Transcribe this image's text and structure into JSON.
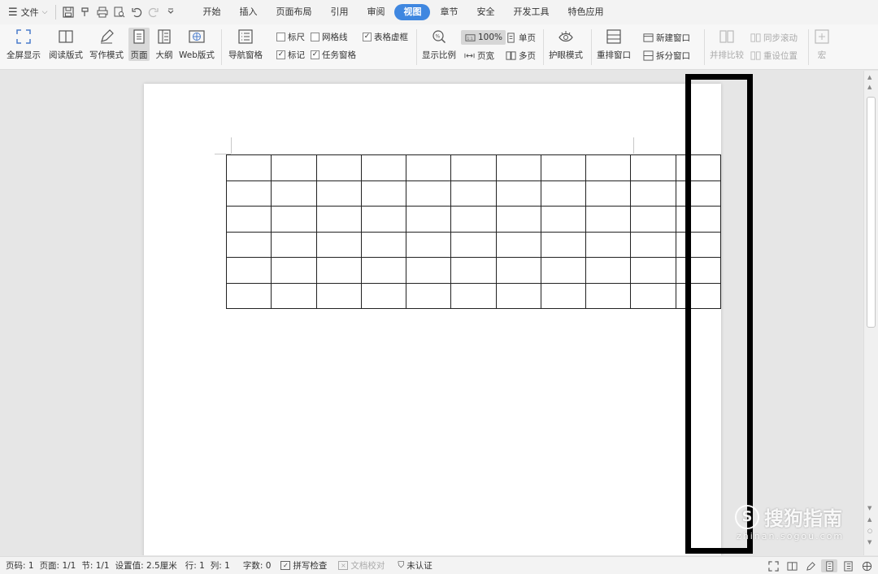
{
  "menubar": {
    "file_label": "文件",
    "tabs": [
      "开始",
      "插入",
      "页面布局",
      "引用",
      "审阅",
      "视图",
      "章节",
      "安全",
      "开发工具",
      "特色应用"
    ],
    "active_tab": "视图"
  },
  "ribbon": {
    "fullscreen": "全屏显示",
    "reading": "阅读版式",
    "writing": "写作模式",
    "page": "页面",
    "outline": "大纲",
    "web": "Web版式",
    "nav_pane": "导航窗格",
    "ruler": "标尺",
    "gridlines": "网格线",
    "table_gridlines": "表格虚框",
    "marks": "标记",
    "task_pane": "任务窗格",
    "zoom": "显示比例",
    "zoom_value": "100%",
    "page_width": "页宽",
    "single_page": "单页",
    "multi_page": "多页",
    "eye_mode": "护眼模式",
    "rearrange": "重排窗口",
    "new_window": "新建窗口",
    "split_window": "拆分窗口",
    "side_by_side": "并排比较",
    "sync_scroll": "同步滚动",
    "reset_position": "重设位置",
    "macro": "宏"
  },
  "checkboxes": {
    "ruler": false,
    "gridlines": false,
    "table_gridlines": true,
    "marks": true,
    "task_pane": true
  },
  "document": {
    "table_rows": 6,
    "table_cols": 11
  },
  "watermark": {
    "brand": "搜狗指南",
    "url": "zhinan.sogou.com"
  },
  "statusbar": {
    "page_no": "页码: 1",
    "pages": "页面: 1/1",
    "section": "节: 1/1",
    "setting": "设置值: 2.5厘米",
    "row": "行: 1",
    "col": "列: 1",
    "words": "字数: 0",
    "spell": "拼写检查",
    "proofread": "文档校对",
    "cert": "未认证"
  }
}
